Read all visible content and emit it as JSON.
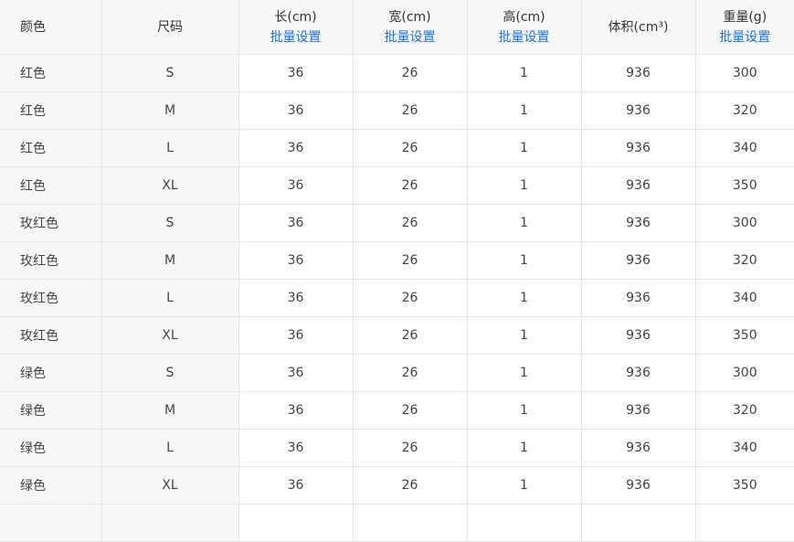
{
  "table": {
    "headers": {
      "color": "颜色",
      "size": "尺码",
      "length": "长(cm)",
      "width": "宽(cm)",
      "height": "高(cm)",
      "volume": "体积(cm³)",
      "weight": "重量(g)",
      "batch_label": "批量设置"
    },
    "rows": [
      {
        "color": "红色",
        "size": "S",
        "length": "36",
        "width": "26",
        "height": "1",
        "volume": "936",
        "weight": "300"
      },
      {
        "color": "红色",
        "size": "M",
        "length": "36",
        "width": "26",
        "height": "1",
        "volume": "936",
        "weight": "320"
      },
      {
        "color": "红色",
        "size": "L",
        "length": "36",
        "width": "26",
        "height": "1",
        "volume": "936",
        "weight": "340"
      },
      {
        "color": "红色",
        "size": "XL",
        "length": "36",
        "width": "26",
        "height": "1",
        "volume": "936",
        "weight": "350"
      },
      {
        "color": "玫红色",
        "size": "S",
        "length": "36",
        "width": "26",
        "height": "1",
        "volume": "936",
        "weight": "300"
      },
      {
        "color": "玫红色",
        "size": "M",
        "length": "36",
        "width": "26",
        "height": "1",
        "volume": "936",
        "weight": "320"
      },
      {
        "color": "玫红色",
        "size": "L",
        "length": "36",
        "width": "26",
        "height": "1",
        "volume": "936",
        "weight": "340"
      },
      {
        "color": "玫红色",
        "size": "XL",
        "length": "36",
        "width": "26",
        "height": "1",
        "volume": "936",
        "weight": "350"
      },
      {
        "color": "绿色",
        "size": "S",
        "length": "36",
        "width": "26",
        "height": "1",
        "volume": "936",
        "weight": "300"
      },
      {
        "color": "绿色",
        "size": "M",
        "length": "36",
        "width": "26",
        "height": "1",
        "volume": "936",
        "weight": "320"
      },
      {
        "color": "绿色",
        "size": "L",
        "length": "36",
        "width": "26",
        "height": "1",
        "volume": "936",
        "weight": "340"
      },
      {
        "color": "绿色",
        "size": "XL",
        "length": "36",
        "width": "26",
        "height": "1",
        "volume": "936",
        "weight": "350"
      }
    ]
  }
}
